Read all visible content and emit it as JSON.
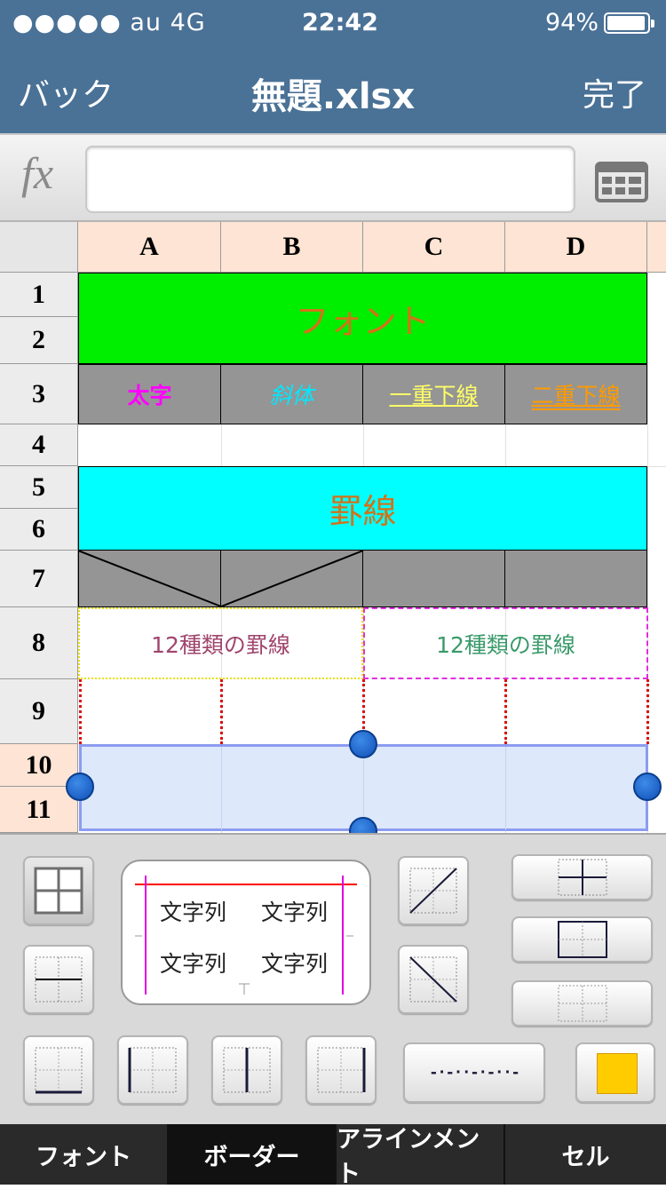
{
  "status": {
    "carrier": "●●●●● au   4G",
    "time": "22:42",
    "battery": "94%"
  },
  "nav": {
    "back": "バック",
    "title": "無題.xlsx",
    "done": "完了"
  },
  "formula": {
    "fx": "fx",
    "value": ""
  },
  "columns": [
    "A",
    "B",
    "C",
    "D"
  ],
  "rows": [
    "1",
    "2",
    "3",
    "4",
    "5",
    "6",
    "7",
    "8",
    "9",
    "10",
    "11"
  ],
  "cells": {
    "r12_title": "フォント",
    "a3": "太字",
    "b3": "斜体",
    "c3": "一重下線",
    "d3": "二重下線",
    "r56_title": "罫線",
    "ab8": "12種類の罫線",
    "cd8": "12種類の罫線"
  },
  "colors": {
    "header": "#4a7196",
    "green": "#00ee00",
    "cyan": "#00ffff",
    "gray": "#959595",
    "selection": "#dde8fb",
    "handle": "#1a5fc8",
    "swatch": "#ffcc00"
  },
  "preview": {
    "t1": "文字列",
    "t2": "文字列",
    "t3": "文字列",
    "t4": "文字列"
  },
  "line_style": "-·-··-·-··-",
  "tabs": [
    "フォント",
    "ボーダー",
    "アラインメント",
    "セル"
  ]
}
